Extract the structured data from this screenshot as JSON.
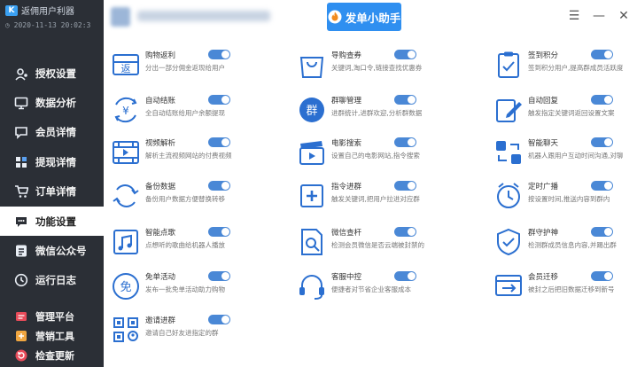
{
  "sidebar": {
    "app_title": "返佣用户利器",
    "datetime": "2020-11-13 20:02:3",
    "nav": [
      {
        "label": "授权设置",
        "icon": "user-key-icon"
      },
      {
        "label": "数据分析",
        "icon": "monitor-icon"
      },
      {
        "label": "会员详情",
        "icon": "chat-user-icon"
      },
      {
        "label": "提现详情",
        "icon": "grid-icon"
      },
      {
        "label": "订单详情",
        "icon": "cart-icon"
      },
      {
        "label": "功能设置",
        "icon": "chat-bubble-icon",
        "active": true
      },
      {
        "label": "微信公众号",
        "icon": "wechat-icon"
      },
      {
        "label": "运行日志",
        "icon": "clock-icon"
      }
    ],
    "bottom": [
      {
        "label": "管理平台",
        "icon": "platform-icon"
      },
      {
        "label": "营销工具",
        "icon": "tool-icon"
      },
      {
        "label": "检查更新",
        "icon": "refresh-icon"
      }
    ]
  },
  "header": {
    "assistant_button": "发单小助手",
    "win": {
      "menu": "☰",
      "minimize": "—",
      "close": "✕"
    }
  },
  "features": [
    {
      "name": "购物返利",
      "desc": "分出一部分佣金返现给用户",
      "icon": "return-box-icon",
      "on": true
    },
    {
      "name": "导购查券",
      "desc": "关键词,淘口令,链接查找优惠券",
      "icon": "shopping-bag-icon",
      "on": true
    },
    {
      "name": "签到积分",
      "desc": "签到积分用户,提高群成员活跃度",
      "icon": "clipboard-icon",
      "on": true
    },
    {
      "name": "自动结账",
      "desc": "全自动结账给用户余额提现",
      "icon": "yuan-cycle-icon",
      "on": true
    },
    {
      "name": "群聊管理",
      "desc": "进群统计,进群欢迎,分析群数据",
      "icon": "group-circle-icon",
      "on": true
    },
    {
      "name": "自动回复",
      "desc": "触发指定关键词返回设置文案",
      "icon": "edit-note-icon",
      "on": true
    },
    {
      "name": "视频解析",
      "desc": "解析主流视频网站的付费视频",
      "icon": "film-icon",
      "on": true
    },
    {
      "name": "电影搜索",
      "desc": "设置自己的电影网站,指令搜索",
      "icon": "movie-clapper-icon",
      "on": true
    },
    {
      "name": "智能聊天",
      "desc": "机器人跟用户互动时间沟通,对聊",
      "icon": "arrows-loop-icon",
      "on": true
    },
    {
      "name": "备份数据",
      "desc": "备份用户数据方便替换转移",
      "icon": "backup-icon",
      "on": true
    },
    {
      "name": "指令进群",
      "desc": "触发关键词,把用户拉进对应群",
      "icon": "plus-box-icon",
      "on": true
    },
    {
      "name": "定时广播",
      "desc": "按设置时间,推送内容到群内",
      "icon": "alarm-clock-icon",
      "on": true
    },
    {
      "name": "智能点歌",
      "desc": "点想听的歌曲给机器人播放",
      "icon": "music-card-icon",
      "on": true
    },
    {
      "name": "微信查杆",
      "desc": "检测会员微信是否云端被封禁的",
      "icon": "doc-search-icon",
      "on": true
    },
    {
      "name": "群守护神",
      "desc": "检测群成员信息内容,并踢出群",
      "icon": "shield-check-icon",
      "on": true
    },
    {
      "name": "免单活动",
      "desc": "发布一批免单活动助力购物",
      "icon": "free-circle-icon",
      "on": true
    },
    {
      "name": "客服中控",
      "desc": "便捷者对节省企业客服成本",
      "icon": "headset-icon",
      "on": true
    },
    {
      "name": "会员迁移",
      "desc": "被封之后把旧数据迁移到新号",
      "icon": "migrate-window-icon",
      "on": true
    },
    {
      "name": "邀请进群",
      "desc": "邀请自己好友进指定的群",
      "icon": "qr-user-icon",
      "on": true
    }
  ]
}
